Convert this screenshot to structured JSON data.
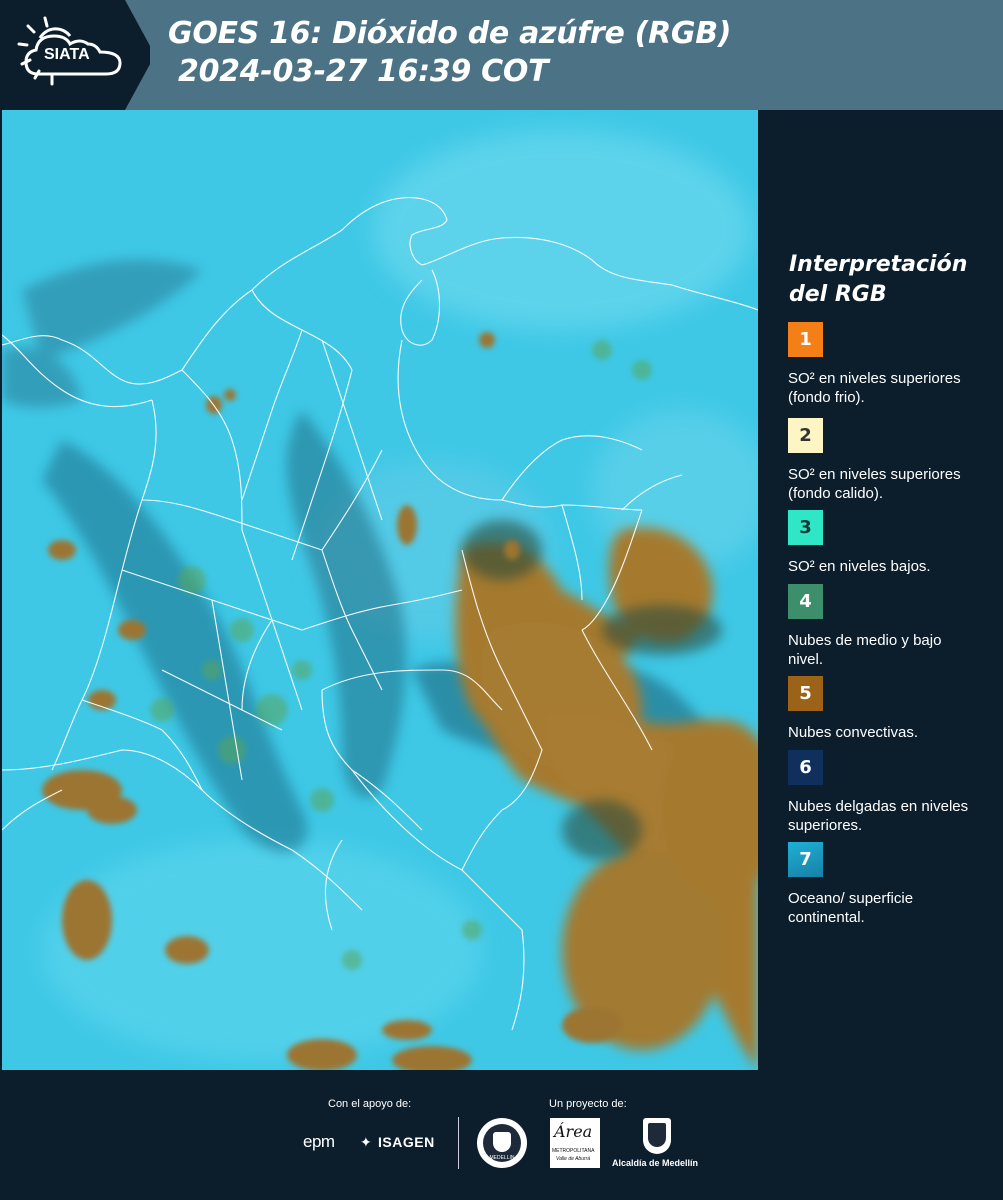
{
  "header": {
    "logo_text": "SIATA",
    "title_line1": "GOES 16: Dióxido de azúfre (RGB)",
    "title_line2": "2024-03-27 16:39 COT",
    "background_color": "#4b7285"
  },
  "legend": {
    "title_line1": "Interpretación",
    "title_line2": "del RGB",
    "items": [
      {
        "number": "1",
        "color": "#f57f17",
        "text_color": "#ffffff",
        "label": "SO² en niveles superiores (fondo frio)."
      },
      {
        "number": "2",
        "color": "#fdf6c4",
        "text_color": "#333333",
        "label": "SO² en niveles superiores (fondo calido)."
      },
      {
        "number": "3",
        "color": "#2fe6c6",
        "text_color": "#1a3a3a",
        "label": "SO² en niveles bajos."
      },
      {
        "number": "4",
        "color": "#3d8f6c",
        "text_color": "#ffffff",
        "label": "Nubes de medio y bajo nivel."
      },
      {
        "number": "5",
        "color": "#9c6218",
        "text_color": "#ffffff",
        "label": "Nubes convectivas."
      },
      {
        "number": "6",
        "color": "#0f2f5c",
        "text_color": "#ffffff",
        "label": "Nubes delgadas en niveles superiores."
      },
      {
        "number": "7",
        "color": "#1f9bc0",
        "text_color": "#ffffff",
        "label": "Oceano/ superficie continental."
      }
    ]
  },
  "footer": {
    "support_label": "Con el apoyo de:",
    "project_label": "Un proyecto de:",
    "sponsor_epm": "epm",
    "sponsor_isagen": "ISAGEN",
    "area_title": "Área",
    "area_sub1": "METROPOLITANA",
    "area_sub2": "Valle de Aburrá",
    "alcaldia": "Alcaldía de Medellín",
    "seal_text": "MEDELLIN"
  },
  "map": {
    "background_color": "#3ec8e6",
    "convective_color": "#a57a2e",
    "border_color": "#ffffff"
  }
}
